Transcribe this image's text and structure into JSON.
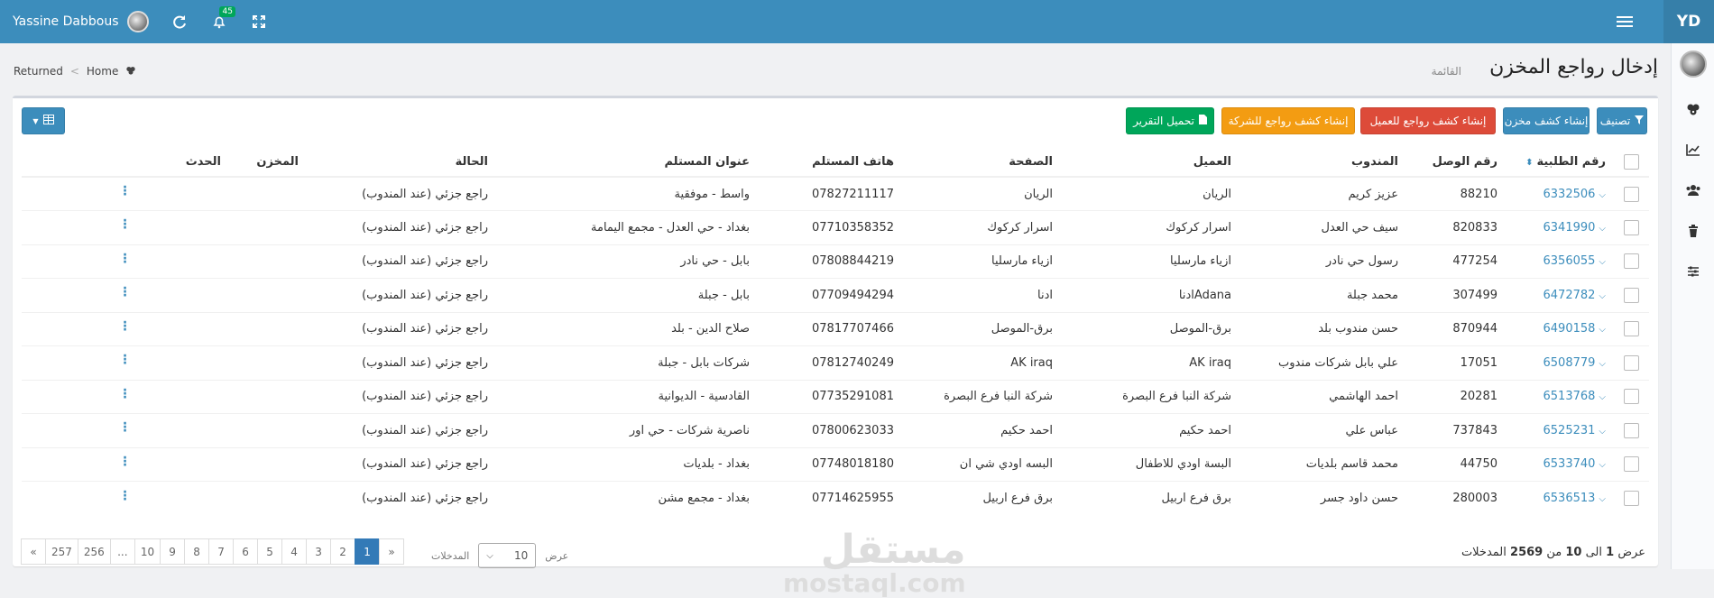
{
  "topbar": {
    "user_name": "Yassine Dabbous",
    "notification_count": "45",
    "brand": "YD"
  },
  "page": {
    "title": "إدخال رواجع المخزن",
    "subtitle": "القائمة"
  },
  "breadcrumb": {
    "home": "Home",
    "current": "Returned"
  },
  "toolbar": {
    "filter_label": "تصنيف",
    "warehouse_statement_label": "إنشاء كشف مخزن",
    "client_returns_label": "إنشاء كشف رواجع للعميل",
    "company_returns_label": "إنشاء كشف رواجع للشركة",
    "download_report_label": "تحميل التقرير"
  },
  "table": {
    "headers": {
      "order_no": "رقم الطلبية",
      "receipt_no": "رقم الوصل",
      "agent": "المندوب",
      "client": "العميل",
      "page": "الصفحة",
      "phone": "هاتف المستلم",
      "address": "عنوان المستلم",
      "status": "الحالة",
      "warehouse": "المخزن",
      "action": "الحدث"
    },
    "rows": [
      {
        "order": "6332506",
        "receipt": "88210",
        "agent": "عزيز كريم",
        "client": "الريان",
        "page": "الريان",
        "phone": "07827211117",
        "address": "واسط - موفقية",
        "status": "راجع جزئي (عند المندوب)",
        "warehouse": ""
      },
      {
        "order": "6341990",
        "receipt": "820833",
        "agent": "سيف حي العدل",
        "client": "اسرار كركوك",
        "page": "اسرار كركوك",
        "phone": "07710358352",
        "address": "بغداد - حي العدل - مجمع اليمامة",
        "status": "راجع جزئي (عند المندوب)",
        "warehouse": ""
      },
      {
        "order": "6356055",
        "receipt": "477254",
        "agent": "رسول حي نادر",
        "client": "ازياء مارسليا",
        "page": "ازياء مارسليا",
        "phone": "07808844219",
        "address": "بابل - حي نادر",
        "status": "راجع جزئي (عند المندوب)",
        "warehouse": ""
      },
      {
        "order": "6472782",
        "receipt": "307499",
        "agent": "محمد جبلة",
        "client": "Adanaادنا",
        "page": "ادنا",
        "phone": "07709494294",
        "address": "بابل - جبلة",
        "status": "راجع جزئي (عند المندوب)",
        "warehouse": ""
      },
      {
        "order": "6490158",
        "receipt": "870944",
        "agent": "حسن مندوب بلد",
        "client": "برق-الموصل",
        "page": "برق-الموصل",
        "phone": "07817707466",
        "address": "صلاح الدين - بلد",
        "status": "راجع جزئي (عند المندوب)",
        "warehouse": ""
      },
      {
        "order": "6508779",
        "receipt": "17051",
        "agent": "علي بابل شركات مندوب",
        "client": "AK iraq",
        "page": "AK iraq",
        "phone": "07812740249",
        "address": "شركات بابل - جبلة",
        "status": "راجع جزئي (عند المندوب)",
        "warehouse": ""
      },
      {
        "order": "6513768",
        "receipt": "20281",
        "agent": "احمد الهاشمي",
        "client": "شركة النبا فرع البصرة",
        "page": "شركة النبا فرع البصرة",
        "phone": "07735291081",
        "address": "القادسية - الديوانية",
        "status": "راجع جزئي (عند المندوب)",
        "warehouse": ""
      },
      {
        "order": "6525231",
        "receipt": "737843",
        "agent": "عباس علي",
        "client": "احمد حكيم",
        "page": "احمد حكيم",
        "phone": "07800623033",
        "address": "ناصرية شركات - حي اور",
        "status": "راجع جزئي (عند المندوب)",
        "warehouse": ""
      },
      {
        "order": "6533740",
        "receipt": "44750",
        "agent": "محمد قاسم بلديات",
        "client": "البسة اودي للاطفال",
        "page": "البسه اودي شي ان",
        "phone": "07748018180",
        "address": "بغداد - بلديات",
        "status": "راجع جزئي (عند المندوب)",
        "warehouse": ""
      },
      {
        "order": "6536513",
        "receipt": "280003",
        "agent": "حسن داود جسر",
        "client": "برق فرع اربيل",
        "page": "برق فرع اربيل",
        "phone": "07714625955",
        "address": "بغداد - مجمع مشن",
        "status": "راجع جزئي (عند المندوب)",
        "warehouse": ""
      }
    ]
  },
  "pagination": {
    "next": "»",
    "prev": "«",
    "pages": [
      "1",
      "2",
      "3",
      "4",
      "5",
      "6",
      "7",
      "8",
      "9",
      "10",
      "...",
      "256",
      "257"
    ],
    "active": "1"
  },
  "length_menu": {
    "show_label": "عرض",
    "entries_label": "المدخلات",
    "value": "10"
  },
  "info": {
    "prefix": "عرض",
    "from": "1",
    "to_word": "الى",
    "to": "10",
    "of_word": "من",
    "total": "2569",
    "suffix": "المدخلات"
  },
  "watermark": {
    "arabic": "مستقل",
    "latin": "mostaql.com"
  },
  "colors": {
    "primary": "#3c8dbc",
    "danger": "#dd4b39",
    "warning": "#f39c12",
    "success": "#00a65a"
  }
}
